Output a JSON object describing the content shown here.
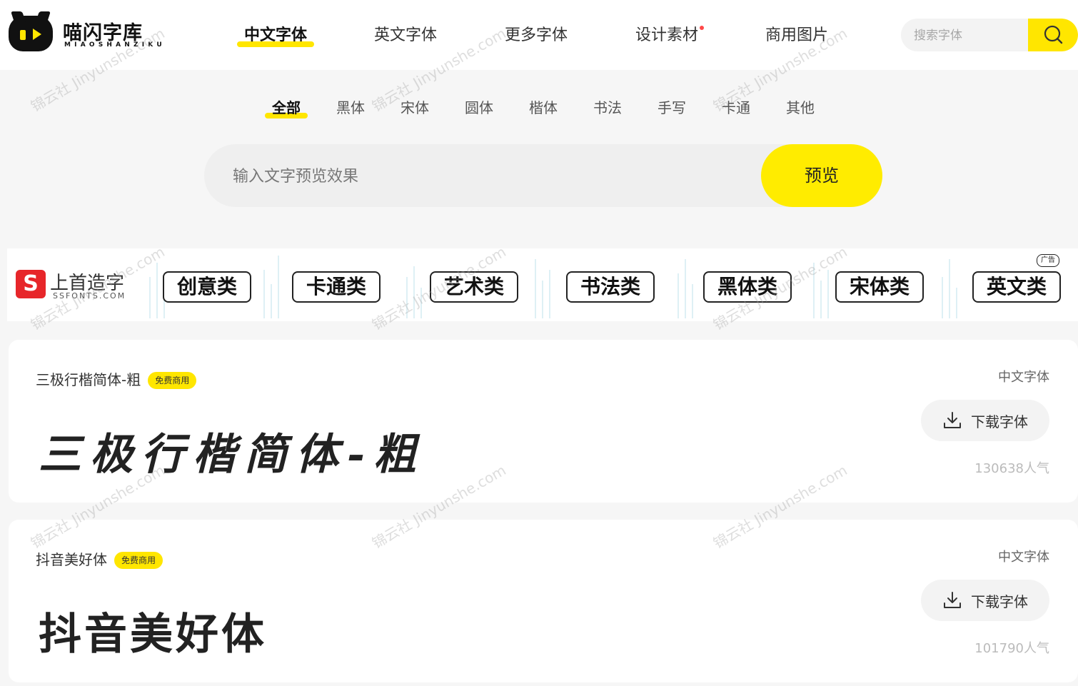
{
  "header": {
    "logo_title": "喵闪字库",
    "logo_sub": "MIAOSHANZIKU",
    "nav": [
      {
        "label": "中文字体",
        "active": true
      },
      {
        "label": "英文字体"
      },
      {
        "label": "更多字体"
      },
      {
        "label": "设计素材",
        "dot": true
      },
      {
        "label": "商用图片"
      }
    ],
    "search_placeholder": "搜索字体"
  },
  "categories": [
    "全部",
    "黑体",
    "宋体",
    "圆体",
    "楷体",
    "书法",
    "手写",
    "卡通",
    "其他"
  ],
  "preview": {
    "placeholder": "输入文字预览效果",
    "button": "预览"
  },
  "banner": {
    "logo_name": "上首造字",
    "logo_mark": "S",
    "logo_url": "SSFONTS.COM",
    "ad_label": "广告",
    "tags": [
      "创意类",
      "卡通类",
      "艺术类",
      "书法类",
      "黑体类",
      "宋体类",
      "英文类"
    ]
  },
  "fonts": [
    {
      "name": "三极行楷简体-粗",
      "badge": "免费商用",
      "category": "中文字体",
      "preview": "三极行楷简体-粗",
      "download": "下载字体",
      "popularity": "130638人气"
    },
    {
      "name": "抖音美好体",
      "badge": "免费商用",
      "category": "中文字体",
      "preview": "抖音美好体",
      "download": "下载字体",
      "popularity": "101790人气"
    }
  ],
  "watermark": "锦云社 Jinyunshe.com",
  "colors": {
    "accent": "#ffe600",
    "preview_button": "#ffec00",
    "banner_logo": "#e7262a"
  }
}
